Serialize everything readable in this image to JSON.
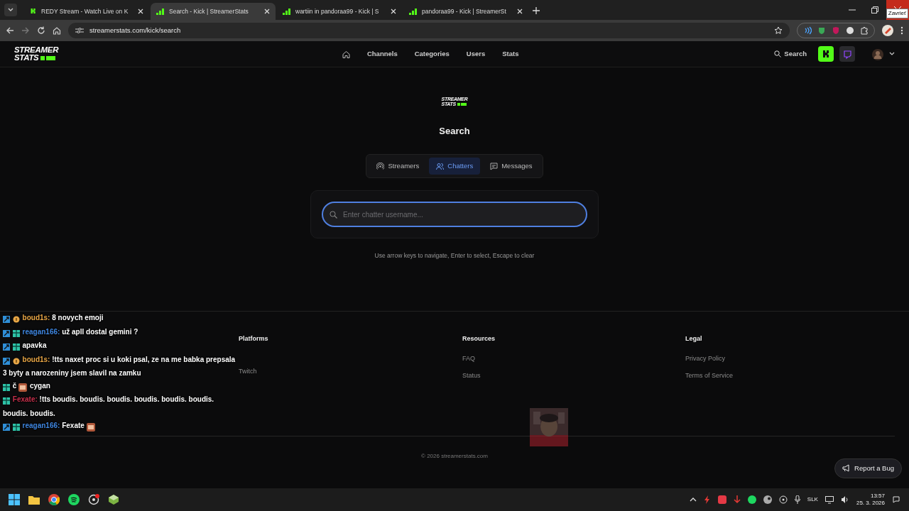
{
  "browser": {
    "tabs": [
      {
        "title": "REDY Stream - Watch Live on K",
        "kind": "kick",
        "selected": false
      },
      {
        "title": "Search - Kick | StreamerStats",
        "kind": "bars",
        "selected": true
      },
      {
        "title": "wartiin in pandoraa99 - Kick | S",
        "kind": "bars",
        "selected": false
      },
      {
        "title": "pandoraa99 - Kick | StreamerSt",
        "kind": "bars",
        "selected": false
      }
    ],
    "url": "streamerstats.com/kick/search",
    "close_tooltip": "Zavrieť"
  },
  "navbar": {
    "logo_lines": [
      "STREAMER",
      "STATS"
    ],
    "links": [
      "Channels",
      "Categories",
      "Users",
      "Stats"
    ],
    "search": "Search",
    "platforms": [
      {
        "kind": "kick",
        "selected": true
      },
      {
        "kind": "twitch",
        "selected": false
      }
    ]
  },
  "search": {
    "logo_lines": [
      "STREAMER",
      "STATS"
    ],
    "title": "Search",
    "modes": [
      {
        "label": "Streamers",
        "kind": "broadcast",
        "selected": false
      },
      {
        "label": "Chatters",
        "kind": "users",
        "selected": true
      },
      {
        "label": "Messages",
        "kind": "message",
        "selected": false
      }
    ],
    "input": {
      "placeholder": "Enter chatter username..."
    },
    "hint": "Use arrow keys to navigate, Enter to select, Escape to clear"
  },
  "footer": {
    "columns": [
      {
        "heading": "Platforms",
        "links": [
          "Twitch"
        ]
      },
      {
        "heading": "Resources",
        "links": [
          "FAQ",
          "Status"
        ]
      },
      {
        "heading": "Legal",
        "links": [
          "Privacy Policy",
          "Terms of Service"
        ]
      }
    ],
    "copyright": "© 2026 streamerstats.com",
    "report": "Report a Bug"
  },
  "chat": [
    {
      "badges": [
        {
          "kind": "mod"
        },
        {
          "kind": "coin"
        }
      ],
      "user": "boud1s:",
      "color": "#e8a646",
      "text": "8 novych emoji"
    },
    {
      "badges": [
        {
          "kind": "mod"
        },
        {
          "kind": "gift"
        }
      ],
      "user": "reagan166:",
      "color": "#3f86e0",
      "text": "už apll dostal gemini ?"
    },
    {
      "badges": [
        {
          "kind": "mod"
        },
        {
          "kind": "gift"
        }
      ],
      "text": "apavka"
    },
    {
      "badges": [
        {
          "kind": "mod"
        },
        {
          "kind": "coin"
        }
      ],
      "user": "boud1s:",
      "color": "#e8a646",
      "text": "!tts naxet proc si u koki psal, ze na me babka prepsala 3 byty a narozeniny jsem slavil na zamku"
    },
    {
      "badges": [
        {
          "kind": "gift"
        }
      ],
      "text": "č",
      "emote": true,
      "after": "cygan"
    },
    {
      "badges": [
        {
          "kind": "gift"
        }
      ],
      "user": "Fexate:",
      "color": "#c8304c",
      "text": "!tts boudis. boudis. boudis. boudis. boudis. boudis. boudis. boudis."
    },
    {
      "badges": [
        {
          "kind": "mod"
        },
        {
          "kind": "gift"
        }
      ],
      "user": "reagan166:",
      "color": "#3f86e0",
      "text": "Fexate",
      "emote": true
    }
  ],
  "taskbar": {
    "language": "SLK",
    "time": "13:57",
    "date": "25. 3. 2026"
  }
}
